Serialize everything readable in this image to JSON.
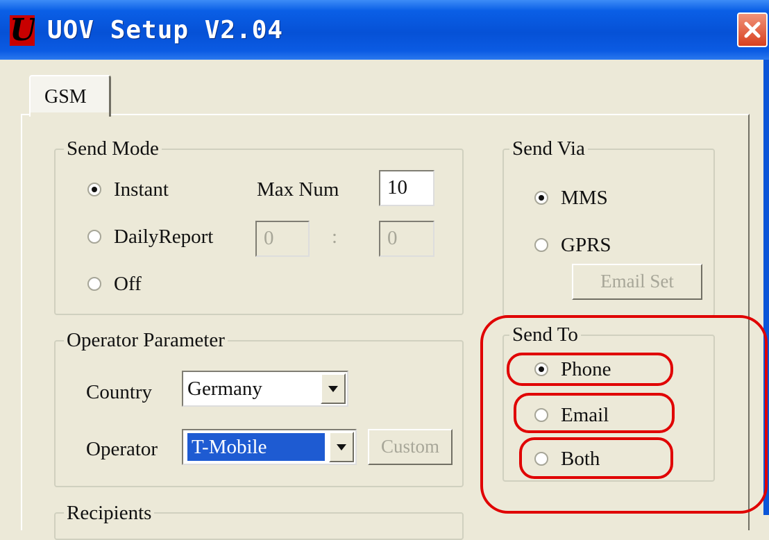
{
  "window": {
    "title": "UOV Setup V2.04",
    "icon": "uov-app-icon",
    "close_icon": "close-icon"
  },
  "tabs": [
    {
      "label": "GSM",
      "selected": true
    }
  ],
  "send_mode": {
    "legend": "Send Mode",
    "options": [
      {
        "label": "Instant",
        "checked": true
      },
      {
        "label": "DailyReport",
        "checked": false
      },
      {
        "label": "Off",
        "checked": false
      }
    ],
    "max_num_label": "Max Num",
    "max_num_value": "10",
    "daily_hour": "0",
    "daily_separator": ":",
    "daily_minute": "0"
  },
  "send_via": {
    "legend": "Send Via",
    "options": [
      {
        "label": "MMS",
        "checked": true
      },
      {
        "label": "GPRS",
        "checked": false
      }
    ],
    "email_set_label": "Email Set"
  },
  "operator_parameter": {
    "legend": "Operator Parameter",
    "country_label": "Country",
    "country_value": "Germany",
    "operator_label": "Operator",
    "operator_value": "T-Mobile",
    "custom_label": "Custom"
  },
  "send_to": {
    "legend": "Send To",
    "options": [
      {
        "label": "Phone",
        "checked": true
      },
      {
        "label": "Email",
        "checked": false
      },
      {
        "label": "Both",
        "checked": false
      }
    ]
  },
  "recipients": {
    "legend": "Recipients"
  },
  "colors": {
    "titlebar": "#0651d6",
    "dialog_bg": "#ece9d8",
    "highlight": "#e00000",
    "selection": "#1e5bd2"
  }
}
